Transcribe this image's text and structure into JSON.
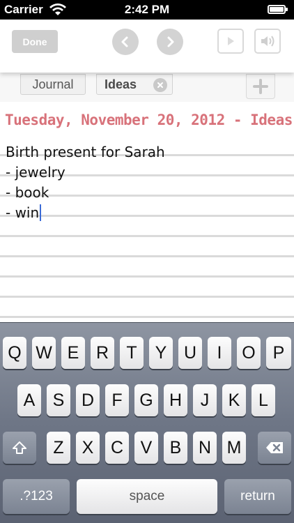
{
  "status_bar": {
    "carrier": "Carrier",
    "time": "2:42 PM",
    "icons": [
      "wifi-icon",
      "battery-icon"
    ]
  },
  "toolbar": {
    "done_label": "Done",
    "icons": [
      "chevron-left-icon",
      "chevron-right-icon",
      "play-icon",
      "speaker-icon"
    ]
  },
  "tags": {
    "items": [
      {
        "label": "Journal"
      },
      {
        "label": "Ideas"
      }
    ],
    "icons": [
      "close-icon",
      "plus-icon"
    ]
  },
  "note": {
    "heading": "Tuesday, November 20, 2012 - Ideas",
    "heading_color": "#d8727a",
    "lines": [
      "Birth present for Sarah",
      "- jewelry",
      "- book",
      "- win"
    ]
  },
  "keyboard": {
    "row1": [
      "Q",
      "W",
      "E",
      "R",
      "T",
      "Y",
      "U",
      "I",
      "O",
      "P"
    ],
    "row2": [
      "A",
      "S",
      "D",
      "F",
      "G",
      "H",
      "J",
      "K",
      "L"
    ],
    "row3": [
      "Z",
      "X",
      "C",
      "V",
      "B",
      "N",
      "M"
    ],
    "numbers_label": ".?123",
    "space_label": "space",
    "return_label": "return",
    "icons": [
      "shift-icon",
      "backspace-icon"
    ]
  }
}
